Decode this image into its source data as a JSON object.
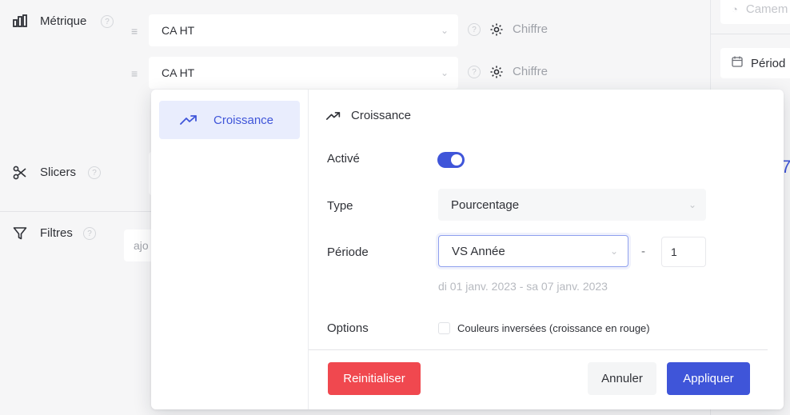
{
  "sidebar": {
    "metric_label": "Métrique",
    "slicers_label": "Slicers",
    "filters_label": "Filtres",
    "filters_placeholder": "ajo",
    "help": "?"
  },
  "metrics": [
    {
      "value": "CA HT",
      "format_label": "Chiffre"
    },
    {
      "value": "CA HT",
      "format_label": "Chiffre"
    }
  ],
  "right_panel": {
    "top_field": "Camem",
    "period_field": "Périod",
    "partial_number": "7"
  },
  "popover": {
    "side_item": "Croissance",
    "header": "Croissance",
    "enabled_label": "Activé",
    "enabled": true,
    "type_label": "Type",
    "type_value": "Pourcentage",
    "period_label": "Période",
    "period_value": "VS Année",
    "period_separator": "-",
    "period_offset": "1",
    "date_range": "di 01 janv. 2023 - sa 07 janv. 2023",
    "options_label": "Options",
    "option_inverse": "Couleurs inversées (croissance en rouge)",
    "reset_label": "Reinitialiser",
    "cancel_label": "Annuler",
    "apply_label": "Appliquer"
  },
  "colors": {
    "accent": "#3f55d9",
    "danger": "#f0484f",
    "background": "#f6f6f7"
  }
}
